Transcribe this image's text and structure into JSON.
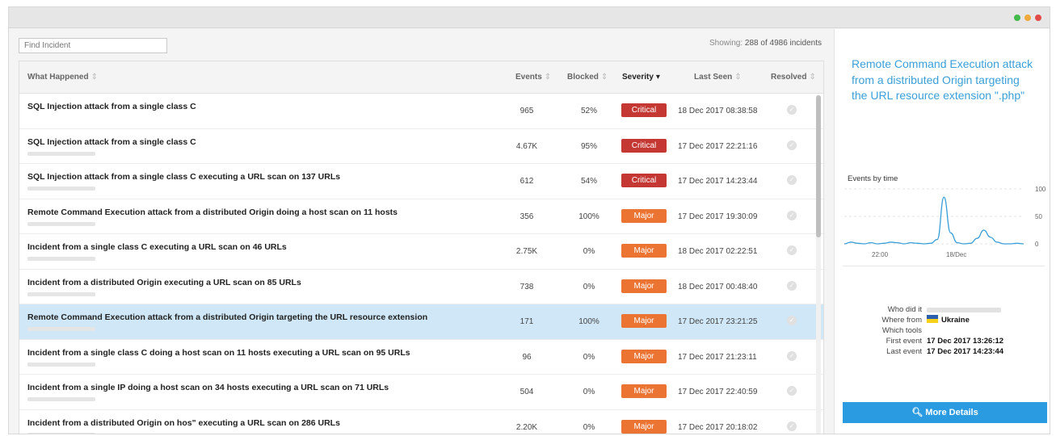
{
  "window": {
    "dots": [
      "#42b94a",
      "#f2a93b",
      "#e14a46"
    ]
  },
  "search": {
    "placeholder": "Find Incident"
  },
  "showing": {
    "prefix": "Showing:",
    "count": "288 of 4986 incidents"
  },
  "table": {
    "columns": {
      "what_happened": "What Happened",
      "events": "Events",
      "blocked": "Blocked",
      "severity": "Severity",
      "last_seen": "Last Seen",
      "resolved": "Resolved"
    },
    "sort_icon": "⇕",
    "active_sort_icon": "▾",
    "rows": [
      {
        "title": "SQL Injection attack from a single class C",
        "events": "965",
        "blocked": "52%",
        "severity": "Critical",
        "last_seen": "18 Dec 2017 08:38:58",
        "selected": false
      },
      {
        "title": "SQL Injection attack from a single class C",
        "events": "4.67K",
        "blocked": "95%",
        "severity": "Critical",
        "last_seen": "17 Dec 2017 22:21:16",
        "selected": false
      },
      {
        "title": "SQL Injection attack from a single class C executing a URL scan on 137 URLs",
        "events": "612",
        "blocked": "54%",
        "severity": "Critical",
        "last_seen": "17 Dec 2017 14:23:44",
        "selected": false
      },
      {
        "title": "Remote Command Execution attack from a distributed Origin doing a host scan on 11 hosts",
        "events": "356",
        "blocked": "100%",
        "severity": "Major",
        "last_seen": "17 Dec 2017 19:30:09",
        "selected": false
      },
      {
        "title": "Incident from a single class C executing a URL scan on 46 URLs",
        "events": "2.75K",
        "blocked": "0%",
        "severity": "Major",
        "last_seen": "18 Dec 2017 02:22:51",
        "selected": false
      },
      {
        "title": "Incident from a distributed Origin executing a URL scan on 85 URLs",
        "events": "738",
        "blocked": "0%",
        "severity": "Major",
        "last_seen": "18 Dec 2017 00:48:40",
        "selected": false
      },
      {
        "title": "Remote Command Execution attack from a distributed Origin targeting the URL resource extension",
        "events": "171",
        "blocked": "100%",
        "severity": "Major",
        "last_seen": "17 Dec 2017 23:21:25",
        "selected": true
      },
      {
        "title": "Incident from a single class C doing a host scan on 11 hosts executing a URL scan on 95 URLs",
        "events": "96",
        "blocked": "0%",
        "severity": "Major",
        "last_seen": "17 Dec 2017 21:23:11",
        "selected": false
      },
      {
        "title": "Incident from a single IP doing a host scan on 34 hosts executing a URL scan on 71 URLs",
        "events": "504",
        "blocked": "0%",
        "severity": "Major",
        "last_seen": "17 Dec 2017 22:40:59",
        "selected": false
      },
      {
        "title": "Incident from a distributed Origin on hos\" executing a URL scan on 286 URLs",
        "events": "2.20K",
        "blocked": "0%",
        "severity": "Major",
        "last_seen": "17 Dec 2017 20:18:02",
        "selected": false
      }
    ]
  },
  "detail": {
    "title": "Remote Command Execution attack from a distributed Origin targeting the URL resource extension \".php\"",
    "events_by_time_label": "Events by time",
    "who_did_it_label": "Who did it",
    "where_from_label": "Where from",
    "where_from_value": "Ukraine",
    "which_tools_label": "Which tools",
    "first_event_label": "First event",
    "first_event_value": "17 Dec 2017 13:26:12",
    "last_event_label": "Last event",
    "last_event_value": "17 Dec 2017 14:23:44",
    "more_details_label": "More Details",
    "more_details_icon": "search-plus-icon"
  },
  "chart_data": {
    "type": "line",
    "title": "Events by time",
    "x_tick_labels": [
      "22:00",
      "18/Dec"
    ],
    "y_ticks": [
      0,
      50,
      100
    ],
    "ylim": [
      0,
      100
    ],
    "grid": "horizontal dashed",
    "color": "#3a9fd8",
    "series": [
      {
        "values": [
          0,
          3,
          1,
          0,
          2,
          0,
          1,
          3,
          2,
          0,
          2,
          1,
          0,
          1,
          8,
          85,
          20,
          2,
          0,
          1,
          10,
          25,
          12,
          3,
          0,
          0,
          1,
          0
        ]
      }
    ]
  }
}
